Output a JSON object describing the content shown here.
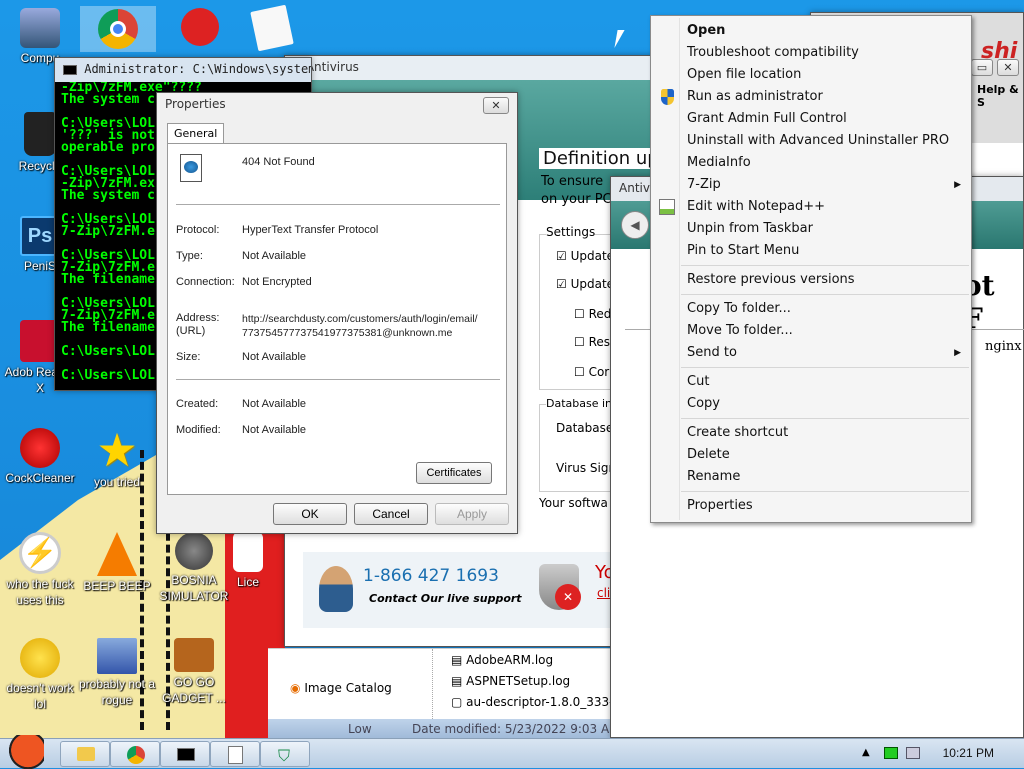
{
  "desktop": {
    "icons": [
      {
        "label": "Compu"
      },
      {
        "label": "Recycle"
      },
      {
        "label": "PeniS"
      },
      {
        "label": "Adob Reader X"
      },
      {
        "label": "CockCleaner"
      },
      {
        "label": "you tried"
      },
      {
        "label": "who the fuck uses this"
      },
      {
        "label": "BEEP BEEP"
      },
      {
        "label": "BOSNIA SIMULATOR"
      },
      {
        "label": "Lice"
      },
      {
        "label": "doesn't work lol"
      },
      {
        "label": "probably not a rogue"
      },
      {
        "label": "GO GO GADGET ..."
      }
    ]
  },
  "cmd": {
    "title": "Administrator: C:\\Windows\\system32",
    "lines": [
      "-Zip\\7zFM.exe\"????",
      "The system c",
      "",
      "C:\\Users\\LOL",
      "'???' is not",
      "operable pro",
      "",
      "C:\\Users\\LOL",
      "-Zip\\7zFM.ex",
      "The system c",
      "",
      "C:\\Users\\LOL",
      "7-Zip\\7zFM.e",
      "",
      "C:\\Users\\LOL",
      "7-Zip\\7zFM.e",
      "The filename",
      "",
      "C:\\Users\\LOL",
      "7-Zip\\7zFM.e",
      "The filename",
      "",
      "C:\\Users\\LOL",
      "",
      "C:\\Users\\LOL"
    ]
  },
  "antivirus": {
    "title": "Antivirus",
    "heading": "Definition up",
    "sub1": "To ensure",
    "sub2": "on your PC",
    "settings": "Settings",
    "update1": "Update",
    "update2": "Update",
    "red": "Red",
    "res": "Res",
    "con": "Cor",
    "db_info": "Database inf",
    "database": "Database",
    "virus_sig": "Virus Sign",
    "your_soft": "Your softwa",
    "phone": "1-866 427 1693",
    "contact": "Contact Our live support",
    "yo": "Yo",
    "cli": "cli"
  },
  "antivirus2": {
    "title": "Antivir"
  },
  "browser": {
    "heading": "ot F",
    "nginx": "nginx",
    "help": "Help & S",
    "brand": "shi"
  },
  "explorer": {
    "files": [
      "AdobeARM.log",
      "ASPNETSetup.log",
      "au-descriptor-1.8.0_333-"
    ],
    "image_catalog": "Image Catalog",
    "low": "Low",
    "date_modified": "Date modified: 5/23/2022 9:03 AM"
  },
  "properties": {
    "title": "Properties",
    "tab": "General",
    "file_name": "404 Not Found",
    "rows": [
      {
        "label": "Protocol:",
        "value": "HyperText Transfer Protocol"
      },
      {
        "label": "Type:",
        "value": "Not Available"
      },
      {
        "label": "Connection:",
        "value": "Not Encrypted"
      },
      {
        "label": "Address:",
        "label2": "(URL)",
        "value": "http://searchdusty.com/customers/auth/login/email/",
        "value2": "773754577737541977375381@unknown.me"
      },
      {
        "label": "Size:",
        "value": "Not Available"
      },
      {
        "label": "Created:",
        "value": "Not Available"
      },
      {
        "label": "Modified:",
        "value": "Not Available"
      }
    ],
    "certificates": "Certificates",
    "ok": "OK",
    "cancel": "Cancel",
    "apply": "Apply"
  },
  "context_menu": {
    "groups": [
      [
        {
          "label": "Open",
          "bold": true
        },
        {
          "label": "Troubleshoot compatibility"
        },
        {
          "label": "Open file location"
        },
        {
          "label": "Run as administrator",
          "icon": "shield-icon"
        },
        {
          "label": "Grant Admin Full Control"
        },
        {
          "label": "Uninstall with Advanced Uninstaller PRO"
        },
        {
          "label": "MediaInfo"
        },
        {
          "label": "7-Zip",
          "submenu": true
        },
        {
          "label": "Edit with Notepad++",
          "icon": "notepad-icon"
        },
        {
          "label": "Unpin from Taskbar"
        },
        {
          "label": "Pin to Start Menu"
        }
      ],
      [
        {
          "label": "Restore previous versions"
        }
      ],
      [
        {
          "label": "Copy To folder..."
        },
        {
          "label": "Move To folder..."
        },
        {
          "label": "Send to",
          "submenu": true
        }
      ],
      [
        {
          "label": "Cut"
        },
        {
          "label": "Copy"
        }
      ],
      [
        {
          "label": "Create shortcut"
        },
        {
          "label": "Delete"
        },
        {
          "label": "Rename"
        }
      ],
      [
        {
          "label": "Properties"
        }
      ]
    ]
  },
  "taskbar": {
    "clock": "10:21 PM"
  },
  "colors": {
    "desktop": "#1a8fe0",
    "cmd_text": "#00ff00",
    "av_teal": "#2d7f78",
    "phone_blue": "#1a6fb0"
  }
}
